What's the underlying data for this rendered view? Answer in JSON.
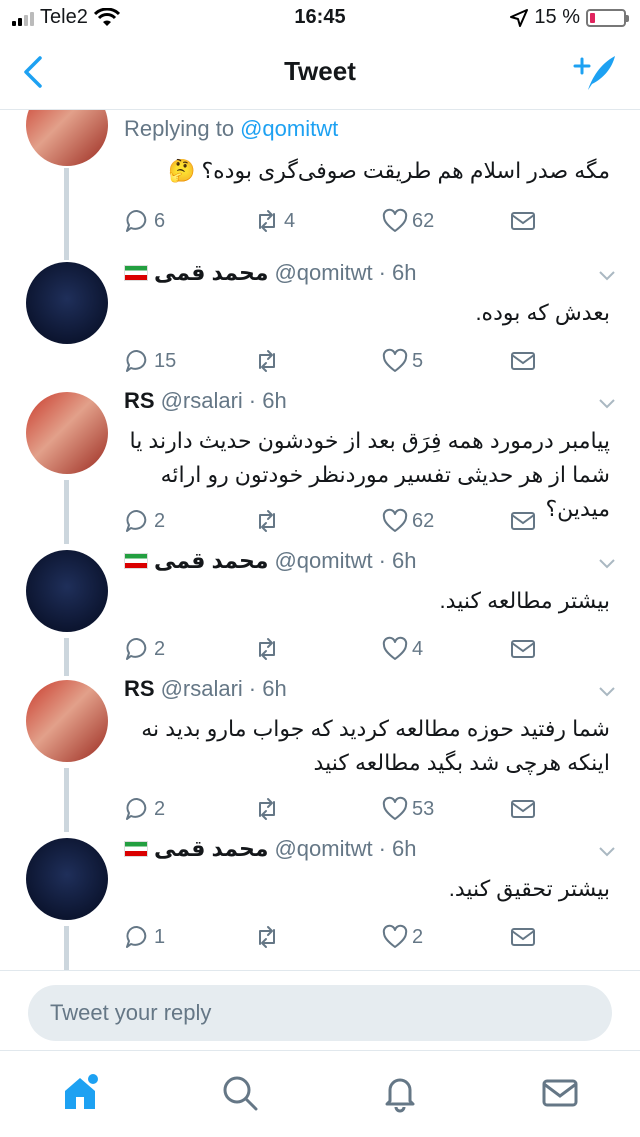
{
  "status_bar": {
    "carrier": "Tele2",
    "time": "16:45",
    "battery": "15 %",
    "battery_level": 0.15
  },
  "nav": {
    "title": "Tweet"
  },
  "tweets": [
    {
      "replying_prefix": "Replying to ",
      "replying_handle": "@qomitwt",
      "text": "مگه صدر اسلام هم طریقت صوفی‌گری بوده؟ 🤔",
      "replies": "6",
      "retweets": "4",
      "likes": "62"
    },
    {
      "name": "محمد قمی",
      "handle": "@qomitwt",
      "time": "· 6h",
      "text": "بعدش که بوده.",
      "replies": "15",
      "retweets": "",
      "likes": "5"
    },
    {
      "name": "RS",
      "handle": "@rsalari",
      "time": "· 6h",
      "text": "پیامبر درمورد همه فِرَق بعد از خودشون حدیث دارند یا شما از هر حدیثی تفسیر موردنظر خودتون رو ارائه میدین؟",
      "replies": "2",
      "retweets": "",
      "likes": "62"
    },
    {
      "name": "محمد قمی",
      "handle": "@qomitwt",
      "time": "· 6h",
      "text": "بیشتر مطالعه کنید.",
      "replies": "2",
      "retweets": "",
      "likes": "4"
    },
    {
      "name": "RS",
      "handle": "@rsalari",
      "time": "· 6h",
      "text": "شما رفتید حوزه مطالعه کردید که جواب مارو بدید نه اینکه هرچی شد بگید مطالعه کنید",
      "replies": "2",
      "retweets": "",
      "likes": "53"
    },
    {
      "name": "محمد قمی",
      "handle": "@qomitwt",
      "time": "· 6h",
      "text": "بیشتر تحقیق کنید.",
      "replies": "1",
      "retweets": "",
      "likes": "2"
    }
  ],
  "reply": {
    "placeholder": "Tweet your reply"
  },
  "colors": {
    "accent": "#1da1f2",
    "muted": "#657786",
    "divider": "#e1e8ed",
    "battery_low": "#e0245e"
  }
}
